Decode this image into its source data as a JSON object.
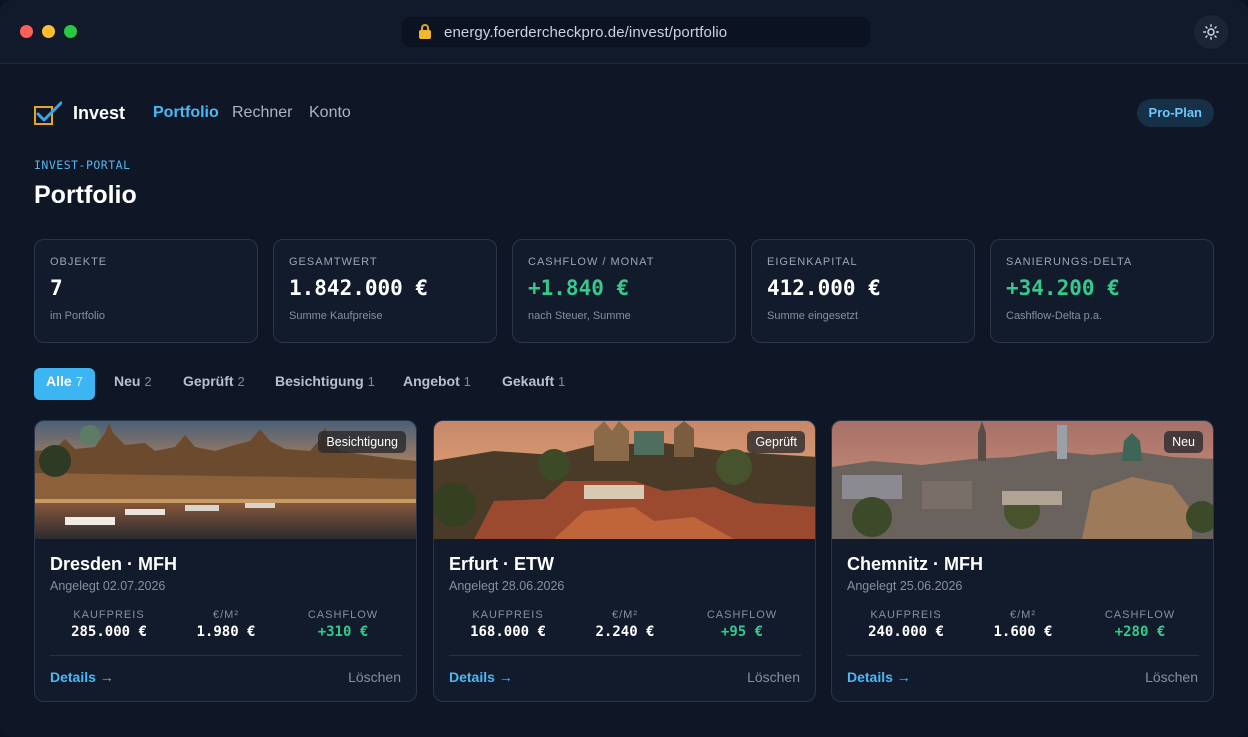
{
  "browser": {
    "url": "energy.foerdercheckpro.de/invest/portfolio",
    "icons": [
      "lock-icon",
      "sun-icon"
    ]
  },
  "nav": {
    "brand": "Invest",
    "links": [
      "Portfolio",
      "Rechner",
      "Konto"
    ],
    "active": "Portfolio",
    "plan_badge": "Pro-Plan"
  },
  "header": {
    "eyebrow": "INVEST-PORTAL",
    "title": "Portfolio"
  },
  "stats": [
    {
      "label": "OBJEKTE",
      "value": "7",
      "sub": "im Portfolio"
    },
    {
      "label": "GESAMTWERT",
      "value": "1.842.000 €",
      "sub": "Summe Kaufpreise"
    },
    {
      "label": "CASHFLOW / MONAT",
      "value": "+1.840 €",
      "sub": "nach Steuer, Summe"
    },
    {
      "label": "EIGENKAPITAL",
      "value": "412.000 €",
      "sub": "Summe eingesetzt"
    },
    {
      "label": "SANIERUNGS-DELTA",
      "value": "+34.200 €",
      "sub": "Cashflow-Delta p.a."
    }
  ],
  "colors": {
    "accent": "#3db5f2",
    "positive": "#35c98b",
    "background": "#0f1726"
  },
  "filters": [
    {
      "label": "Alle",
      "count": "7"
    },
    {
      "label": "Neu",
      "count": "2"
    },
    {
      "label": "Geprüft",
      "count": "2"
    },
    {
      "label": "Besichtigung",
      "count": "1"
    },
    {
      "label": "Angebot",
      "count": "1"
    },
    {
      "label": "Gekauft",
      "count": "1"
    }
  ],
  "active_filter": "Alle",
  "metric_labels": {
    "price": "KAUFPREIS",
    "sqm": "€/M²",
    "cashflow": "CASHFLOW"
  },
  "card_actions": {
    "details": "Details →",
    "delete": "Löschen"
  },
  "properties": [
    {
      "title": "Dresden · MFH",
      "date": "Angelegt 02.07.2026",
      "status": "Besichtigung",
      "price": "285.000 €",
      "sqm": "1.980 €",
      "cashflow": "+310 €"
    },
    {
      "title": "Erfurt · ETW",
      "date": "Angelegt 28.06.2026",
      "status": "Geprüft",
      "price": "168.000 €",
      "sqm": "2.240 €",
      "cashflow": "+95 €"
    },
    {
      "title": "Chemnitz · MFH",
      "date": "Angelegt 25.06.2026",
      "status": "Neu",
      "price": "240.000 €",
      "sqm": "1.600 €",
      "cashflow": "+280 €"
    }
  ]
}
